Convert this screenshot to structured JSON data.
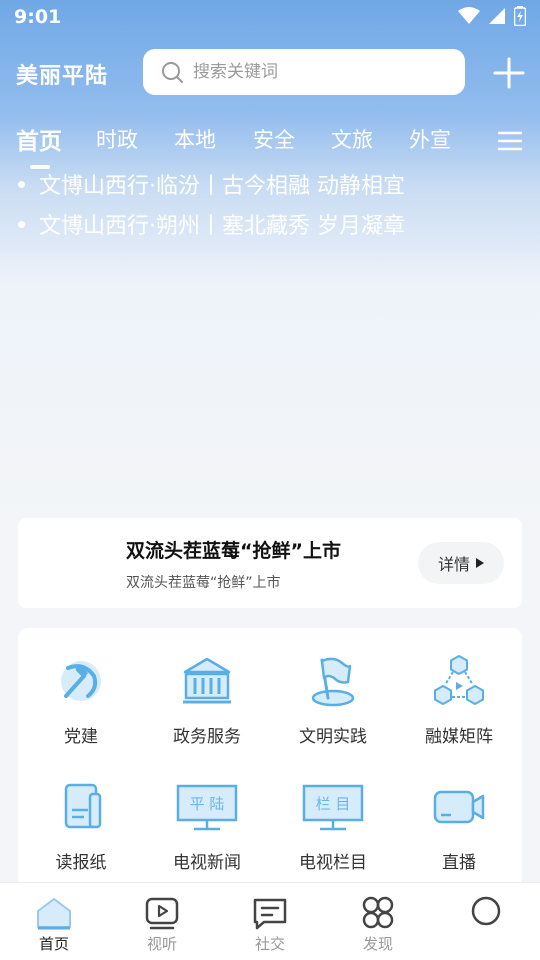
{
  "status_bar": {
    "time": "9:01"
  },
  "header": {
    "app_title": "美丽平陆",
    "search_placeholder": "搜索关键词"
  },
  "tabs": [
    {
      "label": "首页",
      "active": true
    },
    {
      "label": "时政"
    },
    {
      "label": "本地"
    },
    {
      "label": "安全"
    },
    {
      "label": "文旅"
    },
    {
      "label": "外宣"
    }
  ],
  "headlines": [
    "文博山西行·临汾丨古今相融 动静相宜",
    "文博山西行·朔州丨塞北藏秀 岁月凝章"
  ],
  "notice": {
    "title": "双流头茬蓝莓“抢鲜”上市",
    "subtitle": "双流头茬蓝莓“抢鲜”上市",
    "detail_label": "详情"
  },
  "services": [
    {
      "label": "党建",
      "icon": "party-emblem-icon"
    },
    {
      "label": "政务服务",
      "icon": "government-building-icon"
    },
    {
      "label": "文明实践",
      "icon": "flag-icon"
    },
    {
      "label": "融媒矩阵",
      "icon": "hexagon-matrix-icon"
    },
    {
      "label": "读报纸",
      "icon": "newspaper-icon"
    },
    {
      "label": "电视新闻",
      "icon": "tv-news-icon",
      "screen_text": "平 陆"
    },
    {
      "label": "电视栏目",
      "icon": "tv-column-icon",
      "screen_text": "栏 目"
    },
    {
      "label": "直播",
      "icon": "live-camera-icon"
    }
  ],
  "bottom_nav": [
    {
      "label": "首页",
      "active": true
    },
    {
      "label": "视听"
    },
    {
      "label": "社交"
    },
    {
      "label": "发现"
    },
    {
      "label": ""
    }
  ],
  "colors": {
    "accent": "#5aaee6",
    "icon_fill": "#d7ecfa",
    "header_blue": "#6fa8e6"
  }
}
